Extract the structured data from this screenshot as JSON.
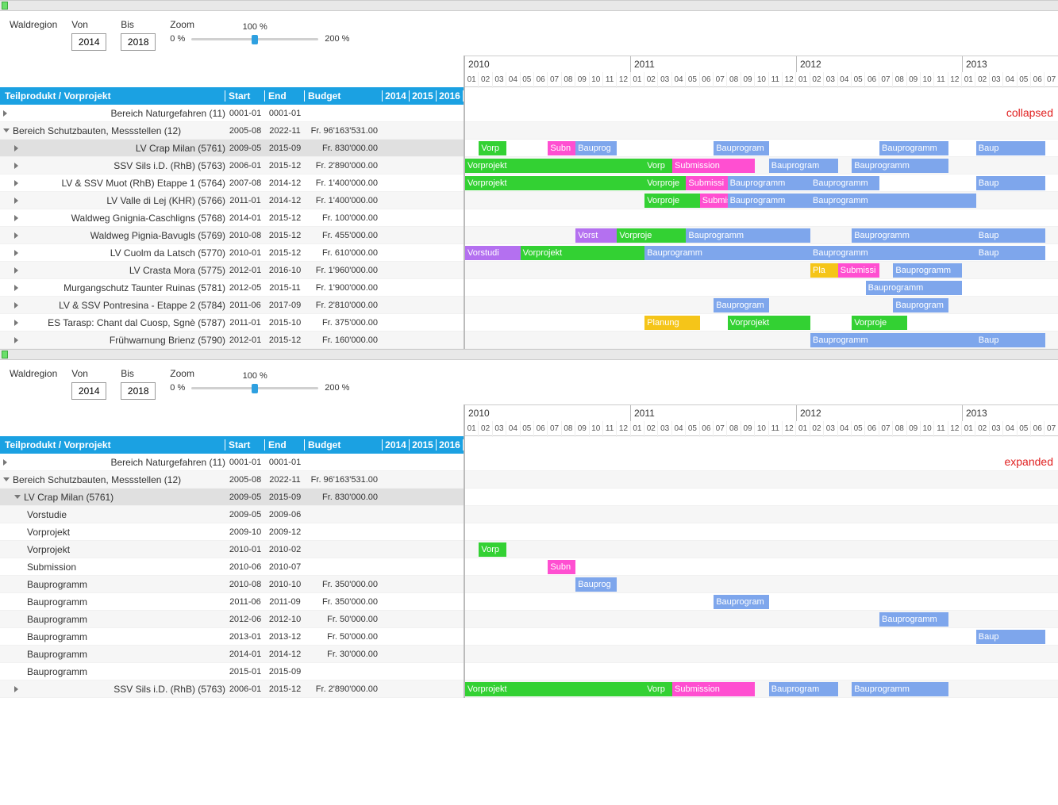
{
  "toolbar": {
    "waldregion": "Waldregion",
    "von": "Von",
    "von_val": "2014",
    "bis": "Bis",
    "bis_val": "2018",
    "zoom": "Zoom",
    "z0": "0 %",
    "z100": "100 %",
    "z200": "200 %"
  },
  "headers": {
    "name": "Teilprodukt / Vorprojekt",
    "start": "Start",
    "end": "End",
    "budget": "Budget",
    "y1": "2014",
    "y2": "2015",
    "y3": "2016"
  },
  "years": [
    "2010",
    "2011",
    "2012",
    "2013"
  ],
  "months": [
    "01",
    "02",
    "03",
    "04",
    "05",
    "06",
    "07",
    "08",
    "09",
    "10",
    "11",
    "12"
  ],
  "annot": {
    "collapsed": "collapsed",
    "expanded": "expanded"
  },
  "rows1": [
    {
      "lvl": 0,
      "exp": "r",
      "name": "Bereich Naturgefahren (11)",
      "start": "0001-01",
      "end": "0001-01",
      "budget": ""
    },
    {
      "lvl": 0,
      "exp": "d",
      "name": "Bereich Schutzbauten, Messstellen (12)",
      "start": "2005-08",
      "end": "2022-11",
      "budget": "Fr. 96'163'531.00",
      "alt": true
    },
    {
      "lvl": 1,
      "exp": "r",
      "name": "LV Crap Milan (5761)",
      "start": "2009-05",
      "end": "2015-09",
      "budget": "Fr. 830'000.00",
      "sel": true
    },
    {
      "lvl": 1,
      "exp": "r",
      "name": "SSV Sils i.D. (RhB) (5763)",
      "start": "2006-01",
      "end": "2015-12",
      "budget": "Fr. 2'890'000.00",
      "alt": true
    },
    {
      "lvl": 1,
      "exp": "r",
      "name": "LV & SSV Muot (RhB) Etappe 1 (5764)",
      "start": "2007-08",
      "end": "2014-12",
      "budget": "Fr. 1'400'000.00"
    },
    {
      "lvl": 1,
      "exp": "r",
      "name": "LV Valle di Lej (KHR) (5766)",
      "start": "2011-01",
      "end": "2014-12",
      "budget": "Fr. 1'400'000.00",
      "alt": true
    },
    {
      "lvl": 1,
      "exp": "r",
      "name": "Waldweg Gnignia-Caschligns (5768)",
      "start": "2014-01",
      "end": "2015-12",
      "budget": "Fr. 100'000.00"
    },
    {
      "lvl": 1,
      "exp": "r",
      "name": "Waldweg Pignia-Bavugls (5769)",
      "start": "2010-08",
      "end": "2015-12",
      "budget": "Fr. 455'000.00",
      "alt": true
    },
    {
      "lvl": 1,
      "exp": "r",
      "name": "LV Cuolm da Latsch (5770)",
      "start": "2010-01",
      "end": "2015-12",
      "budget": "Fr. 610'000.00"
    },
    {
      "lvl": 1,
      "exp": "r",
      "name": "LV Crasta Mora  (5775)",
      "start": "2012-01",
      "end": "2016-10",
      "budget": "Fr. 1'960'000.00",
      "alt": true
    },
    {
      "lvl": 1,
      "exp": "r",
      "name": "Murgangschutz Taunter Ruinas (5781)",
      "start": "2012-05",
      "end": "2015-11",
      "budget": "Fr. 1'900'000.00"
    },
    {
      "lvl": 1,
      "exp": "r",
      "name": "LV & SSV Pontresina - Etappe 2 (5784)",
      "start": "2011-06",
      "end": "2017-09",
      "budget": "Fr. 2'810'000.00",
      "alt": true
    },
    {
      "lvl": 1,
      "exp": "r",
      "name": "ES Tarasp: Chant dal Cuosp, Sgnè (5787)",
      "start": "2011-01",
      "end": "2015-10",
      "budget": "Fr. 375'000.00"
    },
    {
      "lvl": 1,
      "exp": "r",
      "name": "Frühwarnung Brienz (5790)",
      "start": "2012-01",
      "end": "2015-12",
      "budget": "Fr. 160'000.00",
      "alt": true
    }
  ],
  "gantt1": [
    [],
    [],
    [
      {
        "s": 1,
        "e": 3,
        "c": "c-green",
        "t": "Vorp"
      },
      {
        "s": 6,
        "e": 8,
        "c": "c-pink",
        "t": "Subn"
      },
      {
        "s": 8,
        "e": 11,
        "c": "c-blue",
        "t": "Bauprog"
      },
      {
        "s": 18,
        "e": 22,
        "c": "c-blue",
        "t": "Bauprogram"
      },
      {
        "s": 30,
        "e": 35,
        "c": "c-blue",
        "t": "Bauprogramm"
      },
      {
        "s": 37,
        "e": 42,
        "c": "c-blue",
        "t": "Baup"
      }
    ],
    [
      {
        "s": 0,
        "e": 13,
        "c": "c-green",
        "t": "Vorprojekt"
      },
      {
        "s": 13,
        "e": 15,
        "c": "c-green",
        "t": "Vorp"
      },
      {
        "s": 15,
        "e": 21,
        "c": "c-pink",
        "t": "Submission"
      },
      {
        "s": 22,
        "e": 27,
        "c": "c-blue",
        "t": "Bauprogram"
      },
      {
        "s": 28,
        "e": 35,
        "c": "c-blue",
        "t": "Bauprogramm"
      }
    ],
    [
      {
        "s": 0,
        "e": 13,
        "c": "c-green",
        "t": "Vorprojekt"
      },
      {
        "s": 13,
        "e": 16,
        "c": "c-green",
        "t": "Vorproje"
      },
      {
        "s": 16,
        "e": 19,
        "c": "c-pink",
        "t": "Submissi"
      },
      {
        "s": 19,
        "e": 25,
        "c": "c-blue",
        "t": "Bauprogramm"
      },
      {
        "s": 25,
        "e": 30,
        "c": "c-blue",
        "t": "Bauprogramm"
      },
      {
        "s": 37,
        "e": 42,
        "c": "c-blue",
        "t": "Baup"
      }
    ],
    [
      {
        "s": 13,
        "e": 17,
        "c": "c-green",
        "t": "Vorproje"
      },
      {
        "s": 17,
        "e": 19,
        "c": "c-pink",
        "t": "Submissi"
      },
      {
        "s": 19,
        "e": 25,
        "c": "c-blue",
        "t": "Bauprogramm"
      },
      {
        "s": 25,
        "e": 37,
        "c": "c-blue",
        "t": "Bauprogramm"
      }
    ],
    [],
    [
      {
        "s": 8,
        "e": 11,
        "c": "c-purple",
        "t": "Vorst"
      },
      {
        "s": 11,
        "e": 16,
        "c": "c-green",
        "t": "Vorproje"
      },
      {
        "s": 16,
        "e": 25,
        "c": "c-blue",
        "t": "Bauprogramm"
      },
      {
        "s": 28,
        "e": 37,
        "c": "c-blue",
        "t": "Bauprogramm"
      },
      {
        "s": 37,
        "e": 42,
        "c": "c-blue",
        "t": "Baup"
      }
    ],
    [
      {
        "s": 0,
        "e": 4,
        "c": "c-purple",
        "t": "Vorstudi"
      },
      {
        "s": 4,
        "e": 13,
        "c": "c-green",
        "t": "Vorprojekt"
      },
      {
        "s": 13,
        "e": 25,
        "c": "c-blue",
        "t": "Bauprogramm"
      },
      {
        "s": 25,
        "e": 37,
        "c": "c-blue",
        "t": "Bauprogramm"
      },
      {
        "s": 37,
        "e": 42,
        "c": "c-blue",
        "t": "Baup"
      }
    ],
    [
      {
        "s": 25,
        "e": 27,
        "c": "c-yellow",
        "t": "Pla"
      },
      {
        "s": 27,
        "e": 30,
        "c": "c-pink",
        "t": "Submissi"
      },
      {
        "s": 31,
        "e": 36,
        "c": "c-blue",
        "t": "Bauprogramm"
      }
    ],
    [
      {
        "s": 29,
        "e": 36,
        "c": "c-blue",
        "t": "Bauprogramm"
      }
    ],
    [
      {
        "s": 18,
        "e": 22,
        "c": "c-blue",
        "t": "Bauprogram"
      },
      {
        "s": 31,
        "e": 35,
        "c": "c-blue",
        "t": "Bauprogram"
      }
    ],
    [
      {
        "s": 13,
        "e": 17,
        "c": "c-yellow",
        "t": "Planung"
      },
      {
        "s": 19,
        "e": 25,
        "c": "c-green",
        "t": "Vorprojekt"
      },
      {
        "s": 28,
        "e": 32,
        "c": "c-green",
        "t": "Vorproje"
      }
    ],
    [
      {
        "s": 25,
        "e": 37,
        "c": "c-blue",
        "t": "Bauprogramm"
      },
      {
        "s": 37,
        "e": 42,
        "c": "c-blue",
        "t": "Baup"
      }
    ]
  ],
  "rows2": [
    {
      "lvl": 0,
      "exp": "r",
      "name": "Bereich Naturgefahren (11)",
      "start": "0001-01",
      "end": "0001-01",
      "budget": ""
    },
    {
      "lvl": 0,
      "exp": "d",
      "name": "Bereich Schutzbauten, Messstellen (12)",
      "start": "2005-08",
      "end": "2022-11",
      "budget": "Fr. 96'163'531.00",
      "alt": true
    },
    {
      "lvl": 1,
      "exp": "d",
      "name": "LV Crap Milan (5761)",
      "start": "2009-05",
      "end": "2015-09",
      "budget": "Fr. 830'000.00",
      "sel": true
    },
    {
      "lvl": 2,
      "exp": "",
      "name": "Vorstudie",
      "start": "2009-05",
      "end": "2009-06",
      "budget": "",
      "alt": true
    },
    {
      "lvl": 2,
      "exp": "",
      "name": "Vorprojekt",
      "start": "2009-10",
      "end": "2009-12",
      "budget": ""
    },
    {
      "lvl": 2,
      "exp": "",
      "name": "Vorprojekt",
      "start": "2010-01",
      "end": "2010-02",
      "budget": "",
      "alt": true
    },
    {
      "lvl": 2,
      "exp": "",
      "name": "Submission",
      "start": "2010-06",
      "end": "2010-07",
      "budget": ""
    },
    {
      "lvl": 2,
      "exp": "",
      "name": "Bauprogramm",
      "start": "2010-08",
      "end": "2010-10",
      "budget": "Fr. 350'000.00",
      "alt": true
    },
    {
      "lvl": 2,
      "exp": "",
      "name": "Bauprogramm",
      "start": "2011-06",
      "end": "2011-09",
      "budget": "Fr. 350'000.00"
    },
    {
      "lvl": 2,
      "exp": "",
      "name": "Bauprogramm",
      "start": "2012-06",
      "end": "2012-10",
      "budget": "Fr. 50'000.00",
      "alt": true
    },
    {
      "lvl": 2,
      "exp": "",
      "name": "Bauprogramm",
      "start": "2013-01",
      "end": "2013-12",
      "budget": "Fr. 50'000.00"
    },
    {
      "lvl": 2,
      "exp": "",
      "name": "Bauprogramm",
      "start": "2014-01",
      "end": "2014-12",
      "budget": "Fr. 30'000.00",
      "alt": true
    },
    {
      "lvl": 2,
      "exp": "",
      "name": "Bauprogramm",
      "start": "2015-01",
      "end": "2015-09",
      "budget": ""
    },
    {
      "lvl": 1,
      "exp": "r",
      "name": "SSV Sils i.D. (RhB) (5763)",
      "start": "2006-01",
      "end": "2015-12",
      "budget": "Fr. 2'890'000.00",
      "alt": true
    }
  ],
  "gantt2": [
    [],
    [],
    [],
    [],
    [],
    [
      {
        "s": 1,
        "e": 3,
        "c": "c-green",
        "t": "Vorp"
      }
    ],
    [
      {
        "s": 6,
        "e": 8,
        "c": "c-pink",
        "t": "Subn"
      }
    ],
    [
      {
        "s": 8,
        "e": 11,
        "c": "c-blue",
        "t": "Bauprog"
      }
    ],
    [
      {
        "s": 18,
        "e": 22,
        "c": "c-blue",
        "t": "Bauprogram"
      }
    ],
    [
      {
        "s": 30,
        "e": 35,
        "c": "c-blue",
        "t": "Bauprogramm"
      }
    ],
    [
      {
        "s": 37,
        "e": 42,
        "c": "c-blue",
        "t": "Baup"
      }
    ],
    [],
    [],
    [
      {
        "s": 0,
        "e": 13,
        "c": "c-green",
        "t": "Vorprojekt"
      },
      {
        "s": 13,
        "e": 15,
        "c": "c-green",
        "t": "Vorp"
      },
      {
        "s": 15,
        "e": 21,
        "c": "c-pink",
        "t": "Submission"
      },
      {
        "s": 22,
        "e": 27,
        "c": "c-blue",
        "t": "Bauprogram"
      },
      {
        "s": 28,
        "e": 35,
        "c": "c-blue",
        "t": "Bauprogramm"
      }
    ]
  ]
}
